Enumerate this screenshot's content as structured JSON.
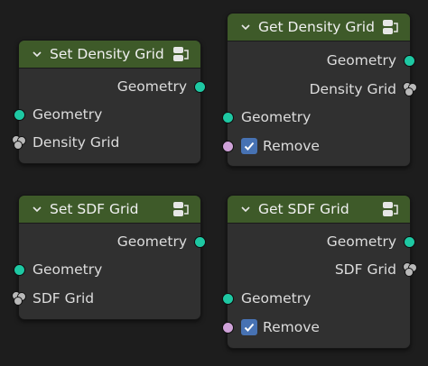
{
  "nodes": {
    "set_density": {
      "title": "Set Density Grid",
      "output_geometry": "Geometry",
      "input_geometry": "Geometry",
      "input_grid": "Density Grid"
    },
    "get_density": {
      "title": "Get Density Grid",
      "output_geometry": "Geometry",
      "output_grid": "Density Grid",
      "input_geometry": "Geometry",
      "remove_label": "Remove",
      "remove_checked": true
    },
    "set_sdf": {
      "title": "Set SDF Grid",
      "output_geometry": "Geometry",
      "input_geometry": "Geometry",
      "input_grid": "SDF Grid"
    },
    "get_sdf": {
      "title": "Get SDF Grid",
      "output_geometry": "Geometry",
      "output_grid": "SDF Grid",
      "input_geometry": "Geometry",
      "remove_label": "Remove",
      "remove_checked": true
    }
  },
  "colors": {
    "header": "#3e5a29",
    "node_body": "#303030",
    "geometry_socket": "#1ec8a3",
    "boolean_socket": "#cfa2d9",
    "checkbox": "#4772b3"
  },
  "icons": {
    "collapse": "chevron-down-icon",
    "node_header": "node-group-icon",
    "grid_socket": "grid-socket-icon"
  }
}
